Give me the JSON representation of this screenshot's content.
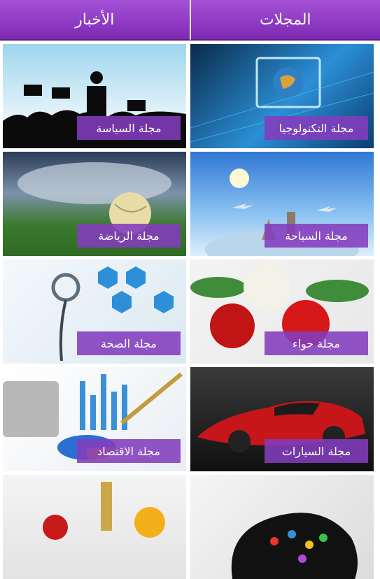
{
  "tabs": {
    "magazines": "المجلات",
    "news": "الأخبار"
  },
  "cards": {
    "technology": "مجلة التكنولوجيا",
    "politics": "مجلة السياسة",
    "tourism": "مجلة السياحة",
    "sports": "مجلة الرياضة",
    "eve": "مجلة حواء",
    "health": "مجلة الصحة",
    "cars": "مجلة السيارات",
    "economy": "مجلة الاقتصاد"
  },
  "colors": {
    "tab_top": "#a451d6",
    "tab_bottom": "#7f29b3",
    "label_bg": "#833cbd"
  }
}
